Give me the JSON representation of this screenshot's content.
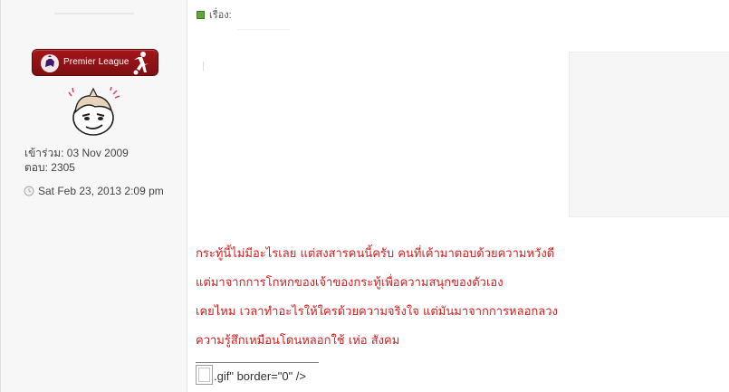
{
  "user_panel": {
    "rank_label": "Premier League",
    "joined": "เข้าร่วม: 03 Nov 2009",
    "posts": "ตอบ: 2305",
    "post_time": "Sat Feb 23, 2013 2:09 pm"
  },
  "post": {
    "subject_label": "เรื่อง:",
    "lines": [
      "กระทู้นี้ไม่มีอะไรเลย แต่สงสารคนนี้ครับ คนที่เค้ามาตอบด้วยความหวังดี",
      "แต่มาจากการโกหกของเจ้าของกระทู้เพื่อความสนุกของตัวเอง",
      "เคยไหม เวลาทำอะไรให้ใครด้วยความจริงใจ แต่มันมาจากการหลอกลวง",
      "ความรู้สึกเหมือนโดนหลอกใช้ เห่อ สังคม"
    ],
    "signature_text": ".gif\" border=\"0\" />"
  },
  "icons": {
    "badge_left": "premier-league-lion-icon",
    "badge_right": "footballer-icon",
    "avatar": "avatar-face",
    "time": "clock-icon",
    "subject": "post-icon",
    "broken_image": "broken-image-icon"
  },
  "colors": {
    "post_text": "#d12020",
    "badge": "#8f1216",
    "subject_icon": "#5fa838",
    "sidebar_bg": "#f7f7f7"
  }
}
